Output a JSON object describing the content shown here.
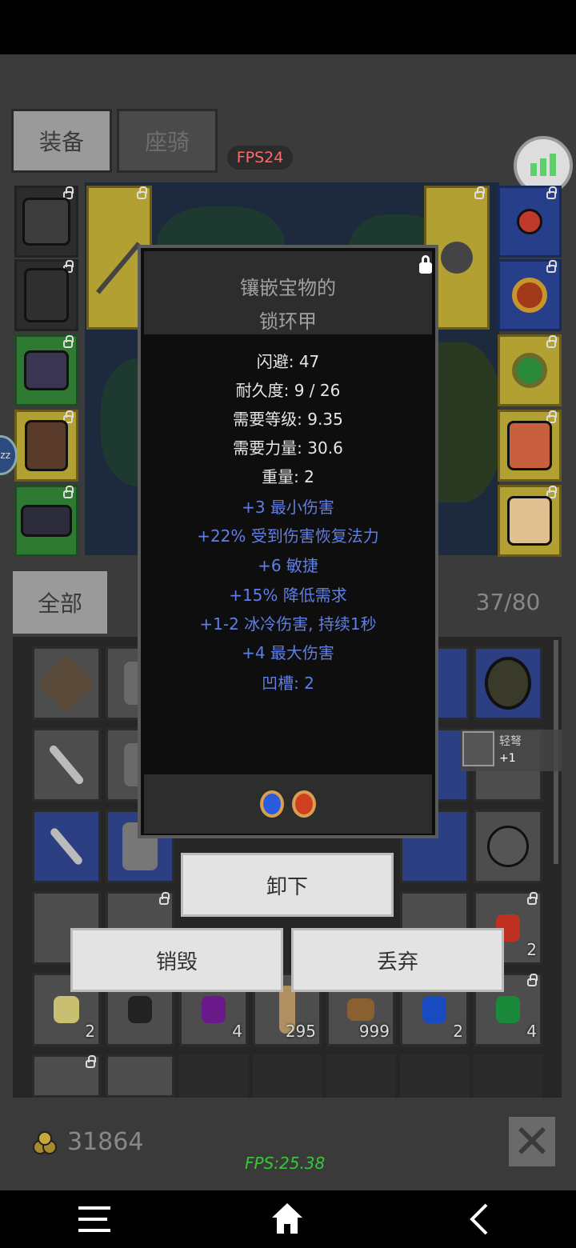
{
  "tabs": {
    "equip": "装备",
    "mount": "座骑"
  },
  "fps_badge": "FPS24",
  "tooltip": {
    "name_line1": "镶嵌宝物的",
    "name_line2": "锁环甲",
    "stats": [
      "闪避: 47",
      "耐久度: 9 / 26",
      "需要等级: 9.35",
      "需要力量: 30.6",
      "重量: 2"
    ],
    "mods": [
      "+3 最小伤害",
      "+22% 受到伤害恢复法力",
      "+6 敏捷",
      "+15% 降低需求",
      "+1-2 冰冷伤害, 持续1秒",
      "+4 最大伤害",
      "凹槽: 2"
    ],
    "sockets": [
      "blue-gem",
      "red-gem"
    ]
  },
  "inventory": {
    "filter_all": "全部",
    "capacity": "37/80",
    "stack_counts": [
      "2",
      "2",
      "4",
      "295",
      "999",
      "2",
      "4",
      "2"
    ]
  },
  "mini_tip": {
    "name": "轻弩",
    "plus": "+1"
  },
  "actions": {
    "unequip": "卸下",
    "destroy": "销毁",
    "drop": "丢弃"
  },
  "gold": "31864",
  "fps_bottom": "FPS:25.38",
  "zz_label": "zz",
  "close_label": "✕",
  "colors": {
    "fps_red": "#ff6b6b",
    "fps_green": "#36c736",
    "mod_blue": "#5f7fe6",
    "slot_gold": "#b3a032",
    "slot_green": "#2f7a33",
    "slot_blue": "#273f8a"
  },
  "icons": [
    "stats-icon",
    "lock-icon",
    "gold-coin-icon",
    "close-icon",
    "menu-icon",
    "home-icon",
    "back-icon"
  ]
}
